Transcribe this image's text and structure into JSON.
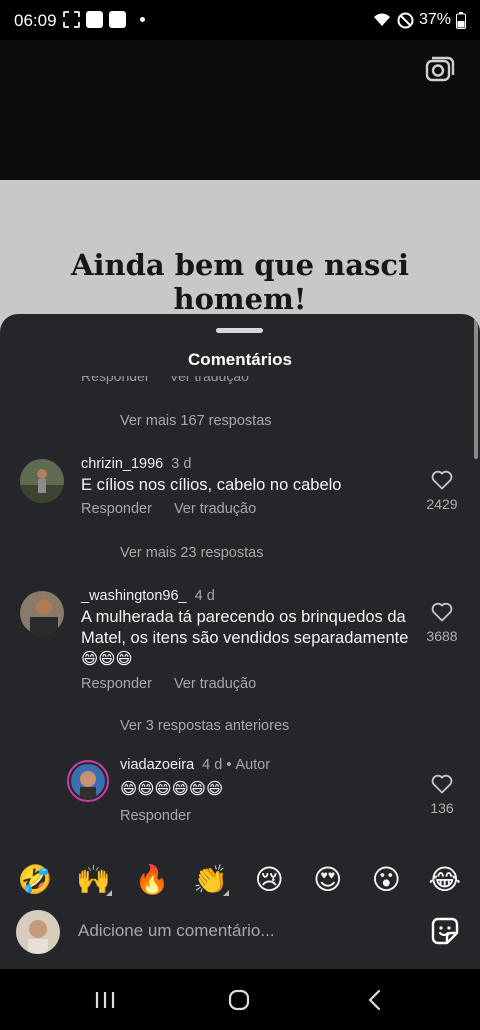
{
  "status_bar": {
    "time": "06:09",
    "battery": "37%"
  },
  "meme": {
    "text": "Ainda bem que nasci homem!"
  },
  "sheet": {
    "title": "Comentários",
    "ghost_actions": {
      "reply": "Responder",
      "translate": "Ver tradução"
    },
    "more_replies_1": "Ver mais 167 respostas"
  },
  "comments": [
    {
      "username": "chrizin_1996",
      "age": "3 d",
      "text": "E cílios nos cílios, cabelo no cabelo",
      "reply": "Responder",
      "translate": "Ver tradução",
      "likes": "2429",
      "more_replies": "Ver mais 23 respostas"
    },
    {
      "username": "_washington96_",
      "age": "4 d",
      "text": "A mulherada tá parecendo os brinquedos da Matel, os itens são vendidos separadamente 😄😄😄",
      "reply": "Responder",
      "translate": "Ver tradução",
      "likes": "3688",
      "more_replies": "Ver 3 respostas anteriores"
    },
    {
      "username": "viadazoeira",
      "age": "4 d",
      "author_badge": "Autor",
      "text": "😄😄😄😄😄😄",
      "reply": "Responder",
      "likes": "136"
    }
  ],
  "reactions": [
    {
      "emoji": "🤣",
      "name": "rolling-laughing"
    },
    {
      "emoji": "🙌",
      "name": "raised-hands"
    },
    {
      "emoji": "🔥",
      "name": "fire"
    },
    {
      "emoji": "👏",
      "name": "clapping-hands"
    },
    {
      "emoji": "😢",
      "name": "crying"
    },
    {
      "emoji": "😍",
      "name": "heart-eyes"
    },
    {
      "emoji": "😮",
      "name": "surprised"
    },
    {
      "emoji": "😂",
      "name": "tears-of-joy"
    }
  ],
  "comment_bar": {
    "placeholder": "Adicione um comentário..."
  },
  "colors": {
    "sheet_bg": "#25262a",
    "meme_bg": "#c8c8c8",
    "muted_text": "#a8a8a8"
  }
}
